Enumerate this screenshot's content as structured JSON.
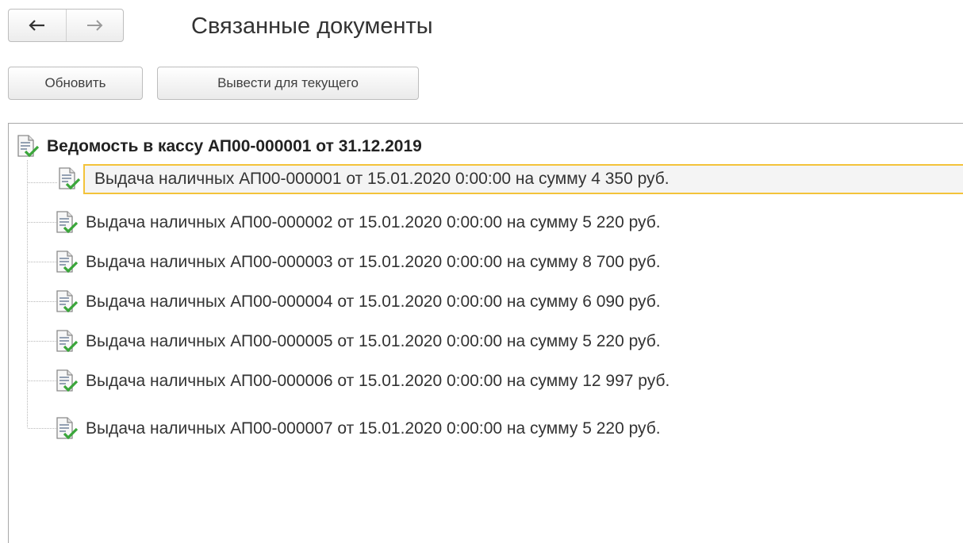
{
  "nav": {
    "back_icon": "arrow-left-icon",
    "forward_icon": "arrow-right-icon"
  },
  "title": "Связанные документы",
  "toolbar": {
    "refresh_label": "Обновить",
    "show_current_label": "Вывести для текущего"
  },
  "tree": {
    "root": {
      "label": "Ведомость в кассу АП00-000001 от 31.12.2019",
      "icon": "posted-document-icon"
    },
    "children": [
      {
        "label": "Выдача наличных АП00-000001 от 15.01.2020 0:00:00 на сумму 4 350 руб.",
        "icon": "posted-document-icon",
        "selected": true
      },
      {
        "label": "Выдача наличных АП00-000002 от 15.01.2020 0:00:00 на сумму 5 220 руб.",
        "icon": "posted-document-icon"
      },
      {
        "label": "Выдача наличных АП00-000003 от 15.01.2020 0:00:00 на сумму 8 700 руб.",
        "icon": "posted-document-icon"
      },
      {
        "label": "Выдача наличных АП00-000004 от 15.01.2020 0:00:00 на сумму 6 090 руб.",
        "icon": "posted-document-icon"
      },
      {
        "label": "Выдача наличных АП00-000005 от 15.01.2020 0:00:00 на сумму 5 220 руб.",
        "icon": "posted-document-icon"
      },
      {
        "label": "Выдача наличных АП00-000006 от 15.01.2020 0:00:00 на сумму 12 997 руб.",
        "icon": "posted-document-icon"
      },
      {
        "label": "Выдача наличных АП00-000007 от 15.01.2020 0:00:00 на сумму 5 220 руб.",
        "icon": "posted-document-icon"
      }
    ]
  },
  "colors": {
    "selection_border": "#f3c33a",
    "check_green": "#3aa63a"
  }
}
